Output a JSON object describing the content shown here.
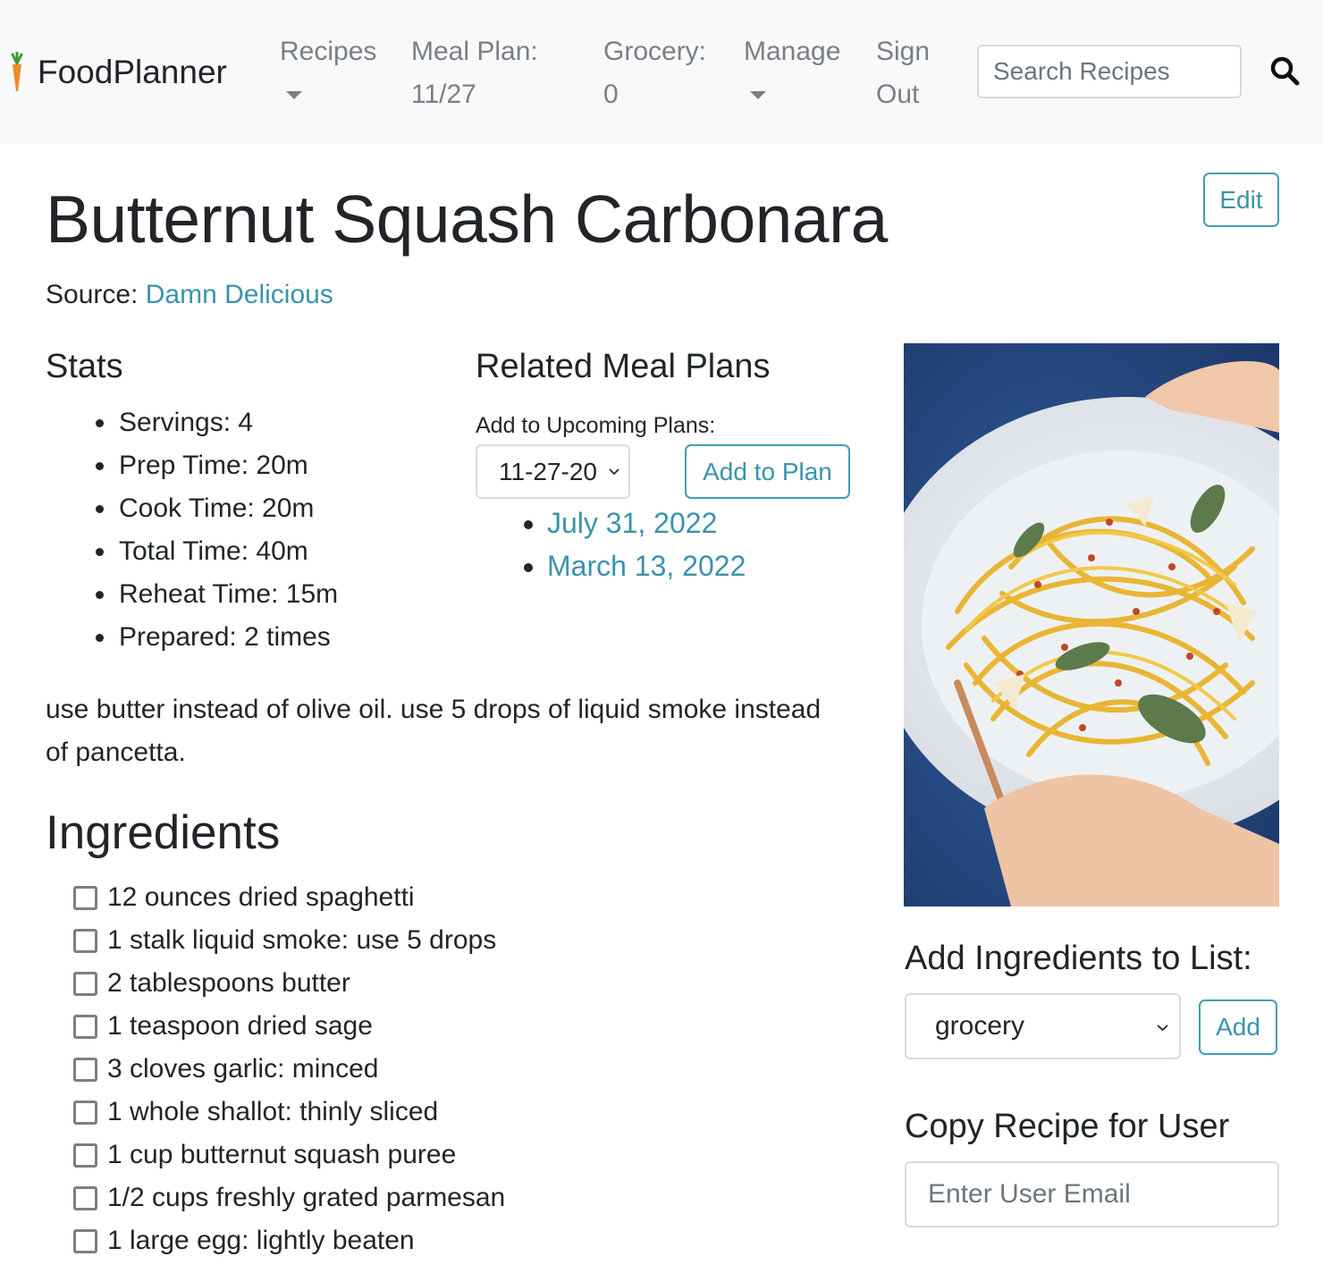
{
  "nav": {
    "brand": "FoodPlanner",
    "recipes": "Recipes",
    "meal_plan_line1": "Meal Plan:",
    "meal_plan_line2": "11/27",
    "grocery_line1": "Grocery:",
    "grocery_line2": "0",
    "manage": "Manage",
    "signout_line1": "Sign",
    "signout_line2": "Out",
    "search_placeholder": "Search Recipes"
  },
  "recipe": {
    "title": "Butternut Squash Carbonara",
    "edit_label": "Edit",
    "source_label": "Source:",
    "source_name": "Damn Delicious",
    "notes": "use butter instead of olive oil. use 5 drops of liquid smoke instead of pancetta."
  },
  "stats": {
    "heading": "Stats",
    "items": [
      "Servings: 4",
      "Prep Time: 20m",
      "Cook Time: 20m",
      "Total Time: 40m",
      "Reheat Time: 15m",
      "Prepared: 2 times"
    ]
  },
  "related": {
    "heading": "Related Meal Plans",
    "upcoming_label": "Add to Upcoming Plans:",
    "selected_plan": "11-27-20",
    "add_button": "Add to Plan",
    "plans": [
      "July 31, 2022",
      "March 13, 2022"
    ]
  },
  "ingredients": {
    "heading": "Ingredients",
    "items": [
      "12 ounces dried spaghetti",
      "1 stalk liquid smoke: use 5 drops",
      "2 tablespoons butter",
      "1 teaspoon dried sage",
      "3 cloves garlic: minced",
      "1 whole shallot: thinly sliced",
      "1 cup butternut squash puree",
      "1/2 cups freshly grated parmesan",
      "1 large egg: lightly beaten"
    ]
  },
  "add_to_list": {
    "heading": "Add Ingredients to List:",
    "selected_list": "grocery",
    "add_button": "Add"
  },
  "copy_recipe": {
    "heading": "Copy Recipe for User",
    "email_placeholder": "Enter User Email"
  },
  "colors": {
    "link": "#3a93ad",
    "navbar_bg": "#f8f9fa",
    "text": "#212529"
  },
  "icons": {
    "brand": "carrot-icon",
    "search": "magnifier-icon",
    "dropdown": "caret-down-icon",
    "select": "chevron-down-icon"
  }
}
